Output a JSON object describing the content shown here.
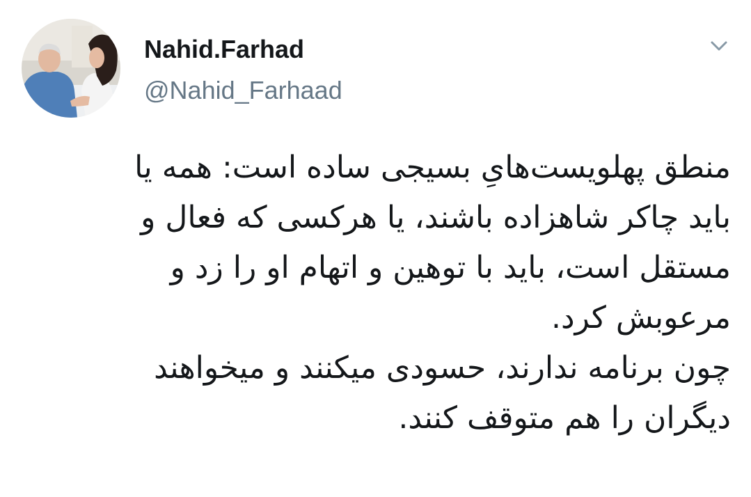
{
  "tweet": {
    "author": {
      "display_name": "Nahid.Farhad",
      "handle": "@Nahid_Farhaad",
      "avatar_icon": "profile-photo"
    },
    "menu_icon": "chevron-down-icon",
    "text_lines": [
      "منطق پهلویست‌هایِ بسیجی ساده است: همه یا",
      "باید چاکر شاهزاده باشند، یا هرکسی که فعال و",
      "مستقل است، باید با توهین و اتهام او را زد و",
      "مرعوبش کرد.",
      "چون برنامه ندارند، حسودی میکنند و میخواهند",
      "دیگران را هم متوقف کنند."
    ]
  },
  "colors": {
    "name": "#14171a",
    "handle": "#657786",
    "chevron": "#8899a6",
    "background": "#ffffff"
  }
}
